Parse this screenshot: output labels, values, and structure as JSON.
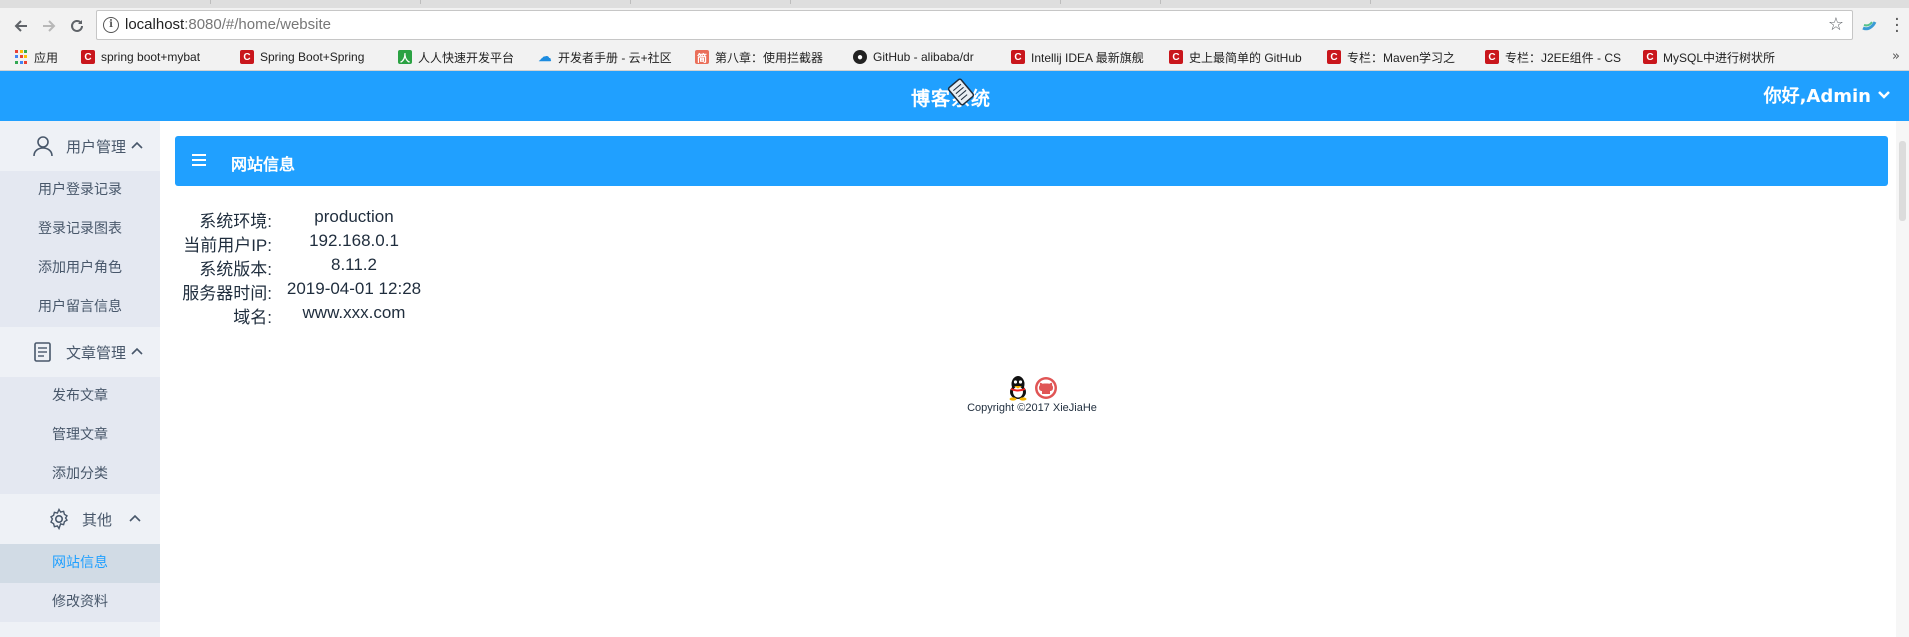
{
  "browser": {
    "url_host": "localhost",
    "url_path": ":8080/#/home/website",
    "bookmarks": [
      {
        "label": "应用",
        "icon": "apps-grid-icon"
      },
      {
        "label": "spring boot+mybat",
        "icon": "csdn-icon"
      },
      {
        "label": "Spring Boot+Spring",
        "icon": "csdn-icon"
      },
      {
        "label": "人人快速开发平台",
        "icon": "renren-icon"
      },
      {
        "label": "开发者手册 - 云+社区",
        "icon": "cloud-icon"
      },
      {
        "label": "第八章：使用拦截器",
        "icon": "jianshu-icon"
      },
      {
        "label": "GitHub - alibaba/dr",
        "icon": "github-icon"
      },
      {
        "label": "Intellij IDEA 最新旗舰",
        "icon": "csdn-icon"
      },
      {
        "label": "史上最简单的 GitHub",
        "icon": "csdn-icon"
      },
      {
        "label": "专栏：Maven学习之",
        "icon": "csdn-icon"
      },
      {
        "label": "专栏：J2EE组件 - CS",
        "icon": "csdn-icon"
      },
      {
        "label": "MySQL中进行树状所",
        "icon": "csdn-icon"
      }
    ],
    "more": "»"
  },
  "header": {
    "logo_text": "博客系统",
    "user_greeting": "你好,Admin",
    "accent_color": "#20a0ff"
  },
  "sidebar": {
    "groups": [
      {
        "label": "用户管理",
        "icon": "user-icon",
        "items": [
          "用户登录记录",
          "登录记录图表",
          "添加用户角色",
          "用户留言信息"
        ]
      },
      {
        "label": "文章管理",
        "icon": "document-icon",
        "items": [
          "发布文章",
          "管理文章",
          "添加分类"
        ]
      },
      {
        "label": "其他",
        "icon": "gear-icon",
        "items": [
          "网站信息",
          "修改资料"
        ]
      }
    ],
    "active_item": "网站信息"
  },
  "main": {
    "panel_title": "网站信息",
    "info": [
      {
        "key": "系统环境:",
        "value": "production"
      },
      {
        "key": "当前用户IP:",
        "value": "192.168.0.1"
      },
      {
        "key": "系统版本:",
        "value": "8.11.2"
      },
      {
        "key": "服务器时间:",
        "value": "2019-04-01 12:28"
      },
      {
        "key": "域名:",
        "value": "www.xxx.com"
      }
    ],
    "footer": {
      "copyright": "Copyright ©2017 XieJiaHe",
      "icons": [
        "qq-icon",
        "github-icon"
      ]
    }
  }
}
